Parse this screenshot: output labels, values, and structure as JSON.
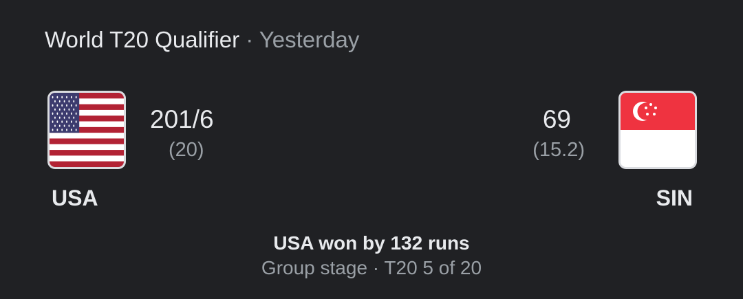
{
  "header": {
    "title": "World T20 Qualifier",
    "separator": " · ",
    "when": "Yesterday"
  },
  "match": {
    "home": {
      "name": "USA",
      "score": "201/6",
      "overs": "(20)",
      "flag_icon": "usa-flag-icon"
    },
    "away": {
      "name": "SIN",
      "score": "69",
      "overs": "(15.2)",
      "flag_icon": "singapore-flag-icon"
    },
    "result": "USA won by 132 runs",
    "stage": "Group stage · T20 5 of 20"
  },
  "colors": {
    "background": "#202124",
    "primary_text": "#e8eaed",
    "secondary_text": "#9aa0a6",
    "usa_red": "#b22234",
    "usa_blue": "#3c3b6e",
    "singapore_red": "#ef3340"
  }
}
